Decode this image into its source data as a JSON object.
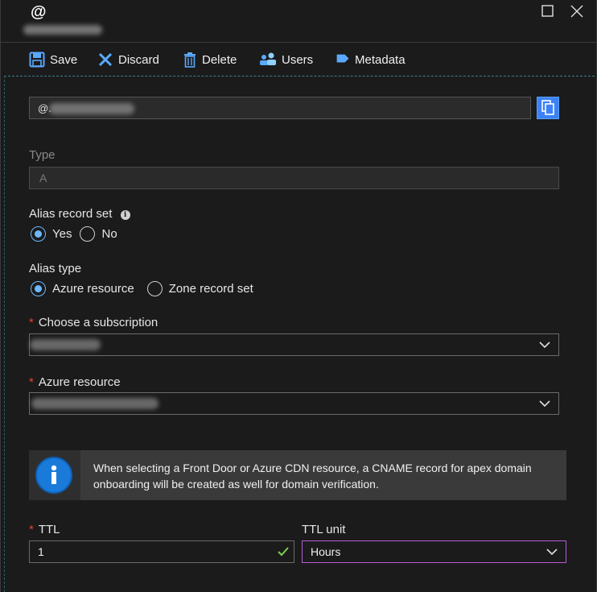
{
  "window": {
    "title": "@"
  },
  "toolbar": {
    "save": "Save",
    "discard": "Discard",
    "delete": "Delete",
    "users": "Users",
    "metadata": "Metadata"
  },
  "name_field": {
    "value": "@."
  },
  "type": {
    "label": "Type",
    "value": "A"
  },
  "alias_record_set": {
    "label": "Alias record set",
    "options": [
      "Yes",
      "No"
    ],
    "selected": "Yes"
  },
  "alias_type": {
    "label": "Alias type",
    "options": [
      "Azure resource",
      "Zone record set"
    ],
    "selected": "Azure resource"
  },
  "subscription": {
    "label": "Choose a subscription",
    "required_mark": "*",
    "value": ""
  },
  "azure_resource": {
    "label": "Azure resource",
    "required_mark": "*",
    "value": ""
  },
  "info_banner": {
    "text": "When selecting a Front Door or Azure CDN resource, a CNAME record for apex domain onboarding will be created as well for domain verification."
  },
  "ttl": {
    "label": "TTL",
    "required_mark": "*",
    "value": "1"
  },
  "ttl_unit": {
    "label": "TTL unit",
    "value": "Hours"
  },
  "colors": {
    "accent": "#3b82f6",
    "radio_selected": "#6cb8ff",
    "required": "#e8412e",
    "valid_check": "#7bd04a",
    "focus_border": "#b55bd6"
  },
  "icons": [
    "save-icon",
    "discard-icon",
    "delete-icon",
    "users-icon",
    "metadata-icon",
    "copy-icon",
    "info-icon",
    "chevron-down-icon",
    "check-icon",
    "maximize-icon",
    "close-icon"
  ]
}
